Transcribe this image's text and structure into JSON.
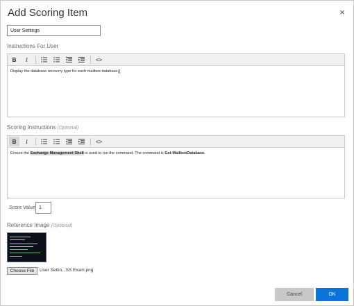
{
  "dialog": {
    "title": "Add Scoring Item",
    "close_glyph": "×"
  },
  "item_name": {
    "value": "User Settings"
  },
  "user_instructions": {
    "label": "Instructions For User",
    "text": "Display the database recovery type for each mailbox database."
  },
  "scoring_instructions": {
    "label": "Scoring Instructions",
    "optional": "(Optional)",
    "text_before": "Ensure the ",
    "highlight": "Exchange Management Shell",
    "text_middle": " is used to run the command. The command is ",
    "command": "Get-MailboxDatabase."
  },
  "toolbar": {
    "bold": "B",
    "italic": "I",
    "code": "<>"
  },
  "score": {
    "label": "Score Value",
    "value": "1"
  },
  "reference_image": {
    "label": "Reference Image",
    "optional": "(Optional)",
    "choose_file": "Choose File",
    "file_name": "User Settin...SS Exam.png"
  },
  "actions": {
    "cancel": "Cancel",
    "ok": "OK"
  }
}
